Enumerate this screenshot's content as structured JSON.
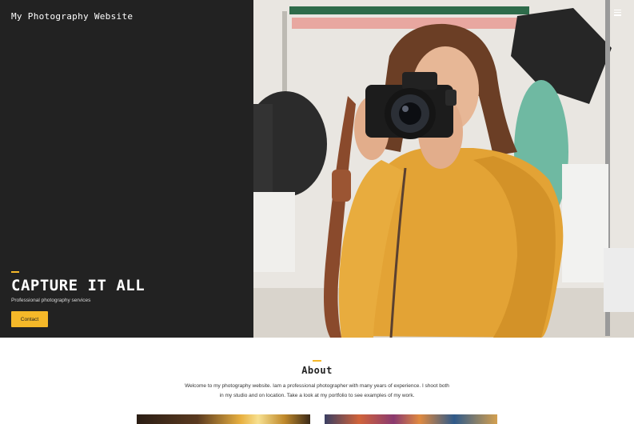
{
  "site": {
    "title": "My Photography Website",
    "accent_color": "#f5b829"
  },
  "hero": {
    "heading": "CAPTURE IT ALL",
    "subtitle": "Professional photography services",
    "button_label": "Contact"
  },
  "about": {
    "heading": "About",
    "text": "Welcome to my photography website. Iam a professional photographer with many years of experience. I shoot both in my studio and on location. Take a look at my portfolio to see examples of my work."
  },
  "icons": {
    "menu": "hamburger-menu-icon"
  }
}
